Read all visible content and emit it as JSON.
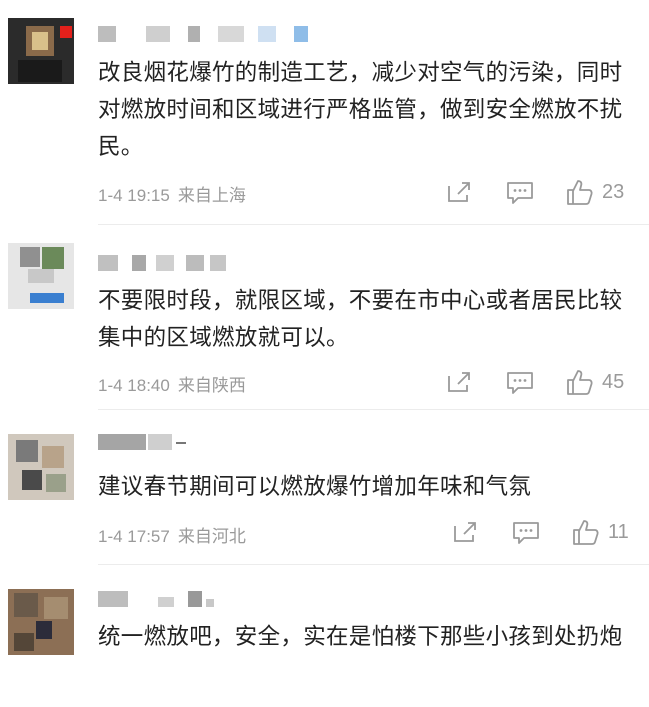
{
  "comments": [
    {
      "text": "改良烟花爆竹的制造工艺，减少对空气的污染，同时对燃放时间和区域进行严格监管，做到安全燃放不扰民。",
      "date": "1-4 19:15",
      "location": "来自上海",
      "likes": "23",
      "avatar_colors": [
        "#2b2b2b",
        "#8a6a4a",
        "#d9c08a",
        "#e3201b",
        "#1a1a1a"
      ]
    },
    {
      "text": "不要限时段，就限区域，不要在市中心或者居民比较集中的区域燃放就可以。",
      "date": "1-4 18:40",
      "location": "来自陕西",
      "likes": "45",
      "avatar_colors": [
        "#c8c8c8",
        "#6b8a5a",
        "#3a7fd0",
        "#e6e6e6",
        "#909090"
      ]
    },
    {
      "text": "建议春节期间可以燃放爆竹增加年味和气氛",
      "date": "1-4 17:57",
      "location": "来自河北",
      "likes": "11",
      "avatar_colors": [
        "#7a7a7a",
        "#b8a38a",
        "#4a4a4a",
        "#d0c8bd",
        "#9aa08a"
      ]
    },
    {
      "text": "统一燃放吧，安全，实在是怕楼下那些小孩到处扔炮",
      "avatar_colors": [
        "#6a5a4a",
        "#8c6f55",
        "#2c2c3a",
        "#a58d70",
        "#544638"
      ]
    }
  ]
}
